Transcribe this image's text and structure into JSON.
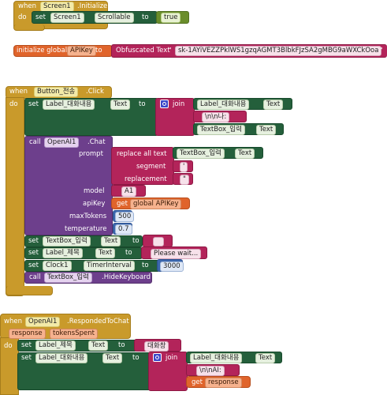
{
  "colors": {
    "control": "#c99a2b",
    "text": "#b3245a",
    "component": "#245f3b",
    "call": "#6d3f8c",
    "variable": "#e0642b",
    "math": "#3b67ad",
    "logic": "#6a8d2b"
  },
  "init": {
    "when": "when",
    "component": "Screen1",
    "event": ".Initialize",
    "do": "do",
    "set": "set",
    "prop_component": "Screen1",
    "prop": "Scrollable",
    "to": "to",
    "value": "true"
  },
  "global": {
    "label": "initialize global",
    "name": "APIKey",
    "to": "to",
    "text_label": "Obfuscated Text",
    "value": "sk-1AYiVEZZPklWS1gzqAGMT3BlbkFJzSA2gMBG9aWXCkOoa"
  },
  "click": {
    "when": "when",
    "button": "Button_전송",
    "event": ".Click",
    "do": "do",
    "set1": {
      "set": "set",
      "comp": "Label_대화내용",
      "prop": "Text",
      "to": "to",
      "join": "join",
      "comp2": "Label_대화내용",
      "prop2": "Text",
      "text": "\\n\\n나:",
      "comp3": "TextBox_입력",
      "prop3": "Text"
    },
    "call": {
      "call": "call",
      "comp": "OpenAI1",
      "method": ".Chat",
      "prompt": "prompt",
      "replace": "replace all text",
      "rcomp": "TextBox_입력",
      "rprop": "Text",
      "segment": "segment",
      "seg_val": "'",
      "replacement": "replacement",
      "rep_val": "\"",
      "model": "model",
      "model_val": "A1",
      "apiKey": "apiKey",
      "get": "get",
      "get_var": "global APIKey",
      "maxTokens": "maxTokens",
      "max_val": "500",
      "temperature": "temperature",
      "temp_val": "0.7"
    },
    "set2": {
      "set": "set",
      "comp": "TextBox_입력",
      "prop": "Text",
      "to": "to",
      "value": ""
    },
    "set3": {
      "set": "set",
      "comp": "Label_제목",
      "prop": "Text",
      "to": "to",
      "value": "Please wait..."
    },
    "set4": {
      "set": "set",
      "comp": "Clock1",
      "prop": "TimerInterval",
      "to": "to",
      "value": "3000"
    },
    "call2": {
      "call": "call",
      "comp": "TextBox_입력",
      "method": ".HideKeyboard"
    }
  },
  "responded": {
    "when": "when",
    "comp": "OpenAI1",
    "event": ".RespondedToChat",
    "param1": "response",
    "param2": "tokensSpent",
    "do": "do",
    "set1": {
      "set": "set",
      "comp": "Label_제목",
      "prop": "Text",
      "to": "to",
      "value": "대화창"
    },
    "set2": {
      "set": "set",
      "comp": "Label_대화내용",
      "prop": "Text",
      "to": "to",
      "join": "join",
      "comp2": "Label_대화내용",
      "prop2": "Text",
      "text": "\\n\\nAI:",
      "get": "get",
      "get_var": "response"
    }
  }
}
